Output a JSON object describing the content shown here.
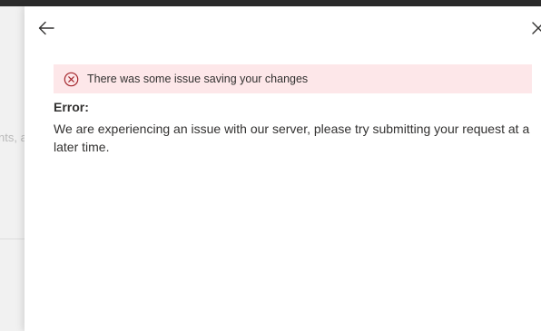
{
  "backdrop": {
    "partial_text": "nts, a"
  },
  "panel": {
    "back_icon": "arrow-left-icon",
    "close_icon": "close-icon",
    "error_bar": {
      "icon": "error-circle-icon",
      "message": "There was some issue saving your changes"
    },
    "error_heading": "Error:",
    "error_body": "We are experiencing an issue with our server, please try submitting your request at a later time."
  },
  "colors": {
    "top_bar": "#2b2b2b",
    "backdrop": "#f1f1f1",
    "error_background": "#fde7e9",
    "error_icon": "#a4262c",
    "text": "#323130"
  }
}
